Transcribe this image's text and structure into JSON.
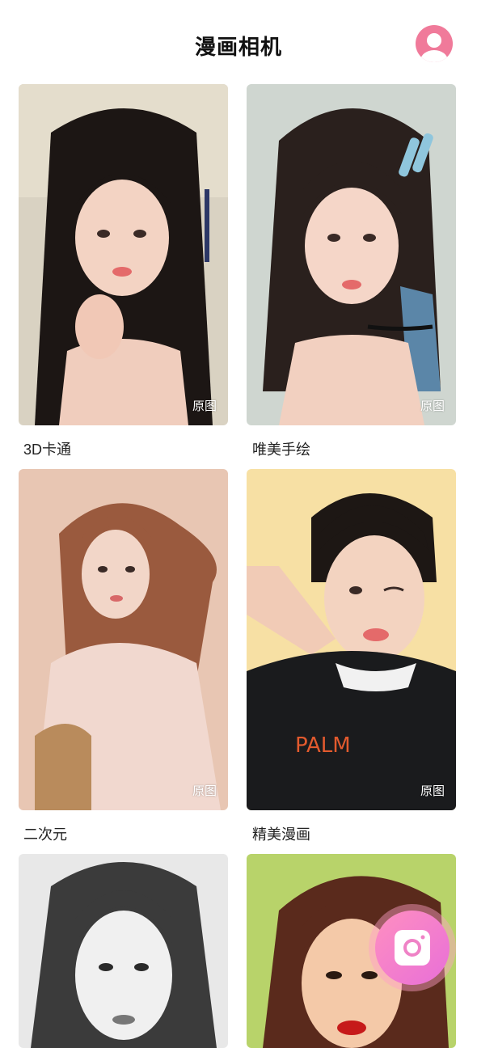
{
  "header": {
    "title": "漫画相机",
    "avatar_icon": "user-avatar-icon"
  },
  "cards": [
    {
      "label": "3D卡通",
      "tag": "原图"
    },
    {
      "label": "唯美手绘",
      "tag": "原图"
    },
    {
      "label": "二次元",
      "tag": "原图"
    },
    {
      "label": "精美漫画",
      "tag": "原图"
    },
    {
      "label": "",
      "tag": ""
    },
    {
      "label": "",
      "tag": ""
    }
  ],
  "fab": {
    "icon": "camera-icon"
  },
  "colors": {
    "accent_pink": "#f07a9a",
    "fab_gradient_start": "#ff8fc0",
    "fab_gradient_end": "#e86fd8"
  }
}
